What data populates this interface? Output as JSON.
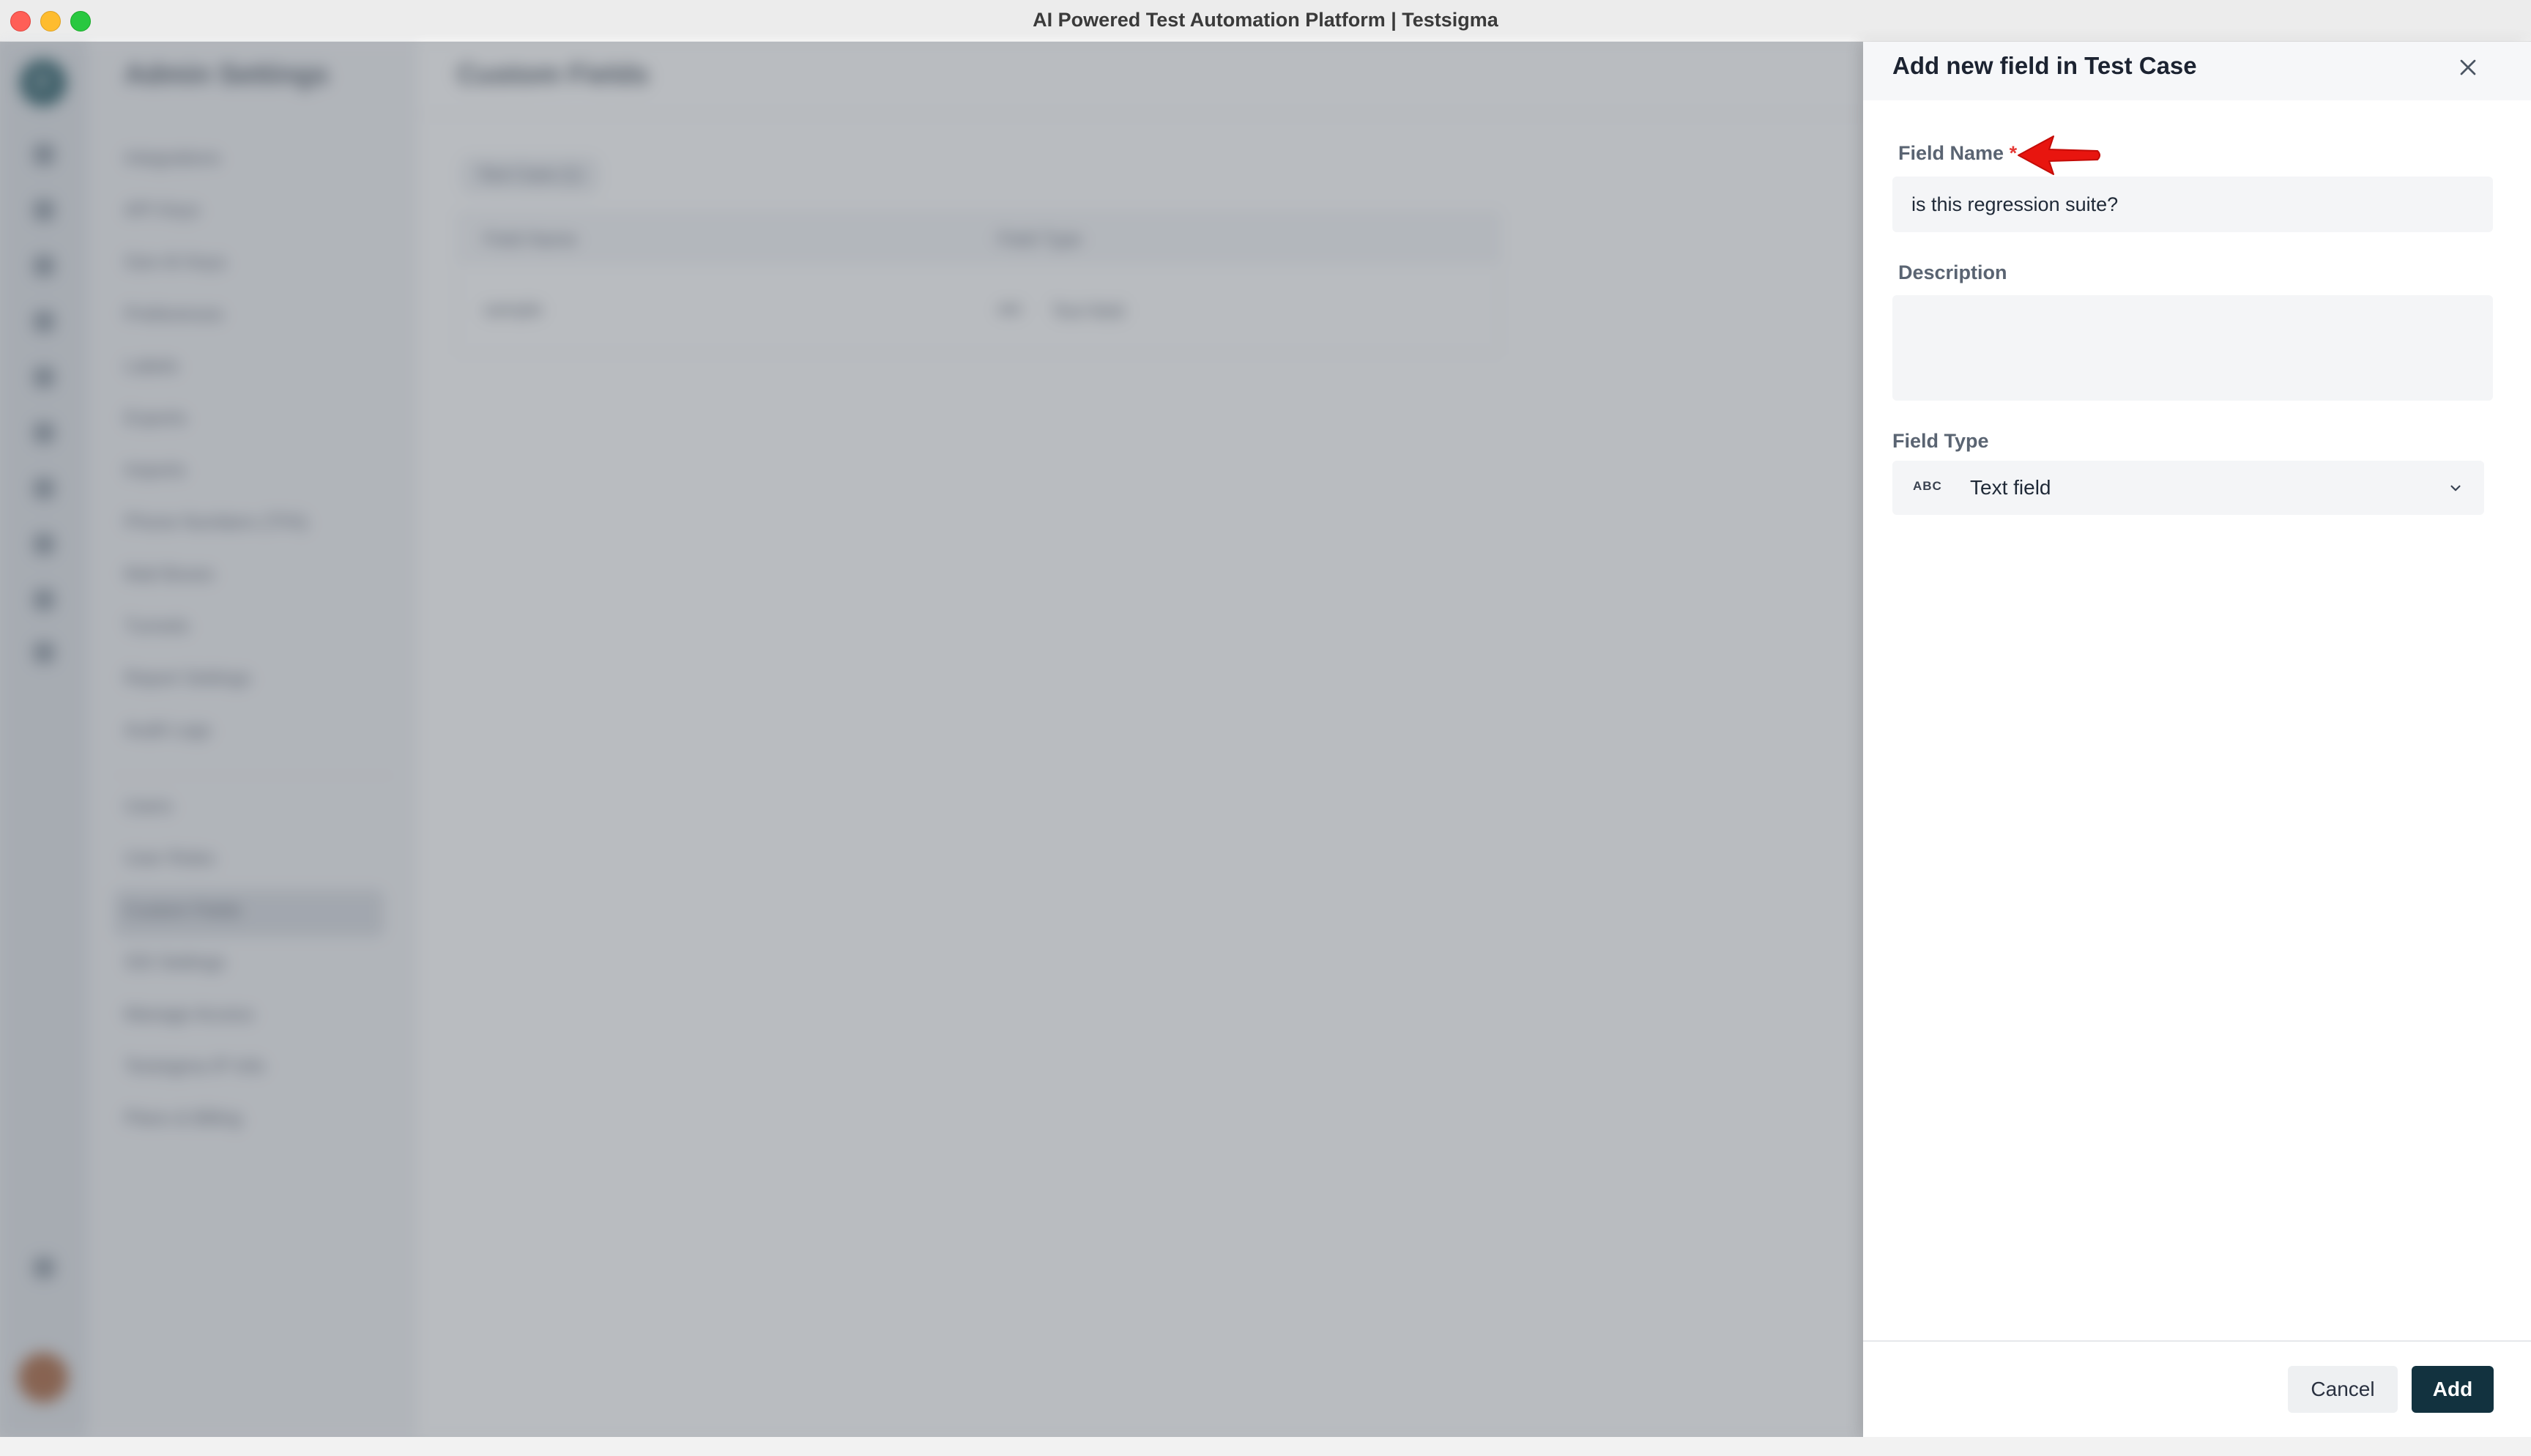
{
  "window": {
    "title": "AI Powered Test Automation Platform | Testsigma"
  },
  "rail": {
    "logo_letter": "F"
  },
  "sidebar": {
    "title": "Admin Settings",
    "items": [
      "Integrations",
      "API Keys",
      "Gen AI Keys",
      "Preferences",
      "Labels",
      "Exports",
      "Imports",
      "Phone Numbers (TFA)",
      "Mail Boxes",
      "Tunnels",
      "Report Settings",
      "Audit Logs"
    ],
    "items2": [
      "Users",
      "User Roles",
      "Custom Fields",
      "SSI Settings",
      "Manage Access",
      "Testsigma IP Info",
      "Plans & Billing"
    ],
    "active_item": "Custom Fields"
  },
  "main": {
    "title": "Custom Fields",
    "tab": "Test Case (1)",
    "table": {
      "headers": [
        "Field Name",
        "Field Type"
      ],
      "rows": [
        {
          "name": "sample",
          "type_icon": "ABC",
          "type": "Text field"
        }
      ]
    }
  },
  "drawer": {
    "title": "Add new field in Test Case",
    "field_name": {
      "label": "Field Name",
      "required_mark": "*",
      "value": "is this regression suite?"
    },
    "description": {
      "label": "Description",
      "value": ""
    },
    "field_type": {
      "label": "Field Type",
      "icon_text": "ABC",
      "selected": "Text field"
    },
    "buttons": {
      "cancel": "Cancel",
      "add": "Add"
    }
  },
  "colors": {
    "primary": "#12323f",
    "required": "#e53935",
    "annotation_arrow": "#e8150f"
  },
  "icons": [
    "close-icon",
    "chevron-down-icon",
    "red-arrow-annotation-icon"
  ]
}
